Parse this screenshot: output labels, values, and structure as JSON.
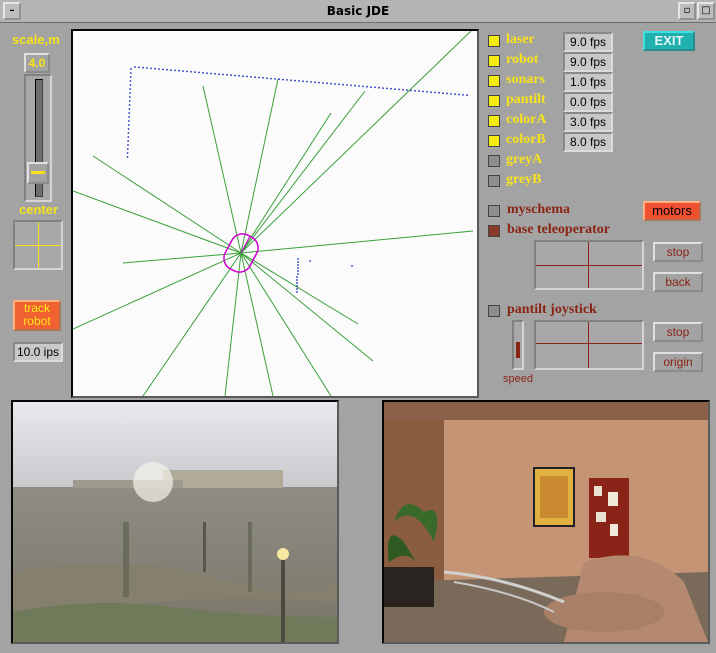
{
  "window": {
    "title": "Basic JDE",
    "close_glyph": "–",
    "min_glyph": "▫",
    "max_glyph": "□"
  },
  "left_panel": {
    "scale_label": "scale,m",
    "scale_value": "4.0",
    "center_label": "center",
    "track_robot_label": [
      "track",
      "robot"
    ],
    "ips_value": "10.0 ips"
  },
  "exit_label": "EXIT",
  "sensors": [
    {
      "label": "laser",
      "fps": "9.0 fps",
      "checked": true
    },
    {
      "label": "robot",
      "fps": "9.0 fps",
      "checked": true
    },
    {
      "label": "sonars",
      "fps": "1.0 fps",
      "checked": true
    },
    {
      "label": "pantilt",
      "fps": "0.0 fps",
      "checked": true
    },
    {
      "label": "colorA",
      "fps": "3.0 fps",
      "checked": true
    },
    {
      "label": "colorB",
      "fps": "8.0 fps",
      "checked": true
    },
    {
      "label": "greyA",
      "checked": false
    },
    {
      "label": "greyB",
      "checked": false
    }
  ],
  "schemas": {
    "myschema_label": "myschema",
    "motors_label": "motors",
    "base_teleoperator_label": "base teleoperator",
    "stop_label": "stop",
    "back_label": "back",
    "pantilt_joystick_label": "pantilt joystick",
    "stop2_label": "stop",
    "origin_label": "origin",
    "speed_label": "speed"
  },
  "colors": {
    "accent_yellow": "#f7e21c",
    "dark_red": "#8a2415",
    "robot_magenta": "#d000d0",
    "sonar_green": "#3aa03a",
    "laser_blue": "#2030c0"
  }
}
